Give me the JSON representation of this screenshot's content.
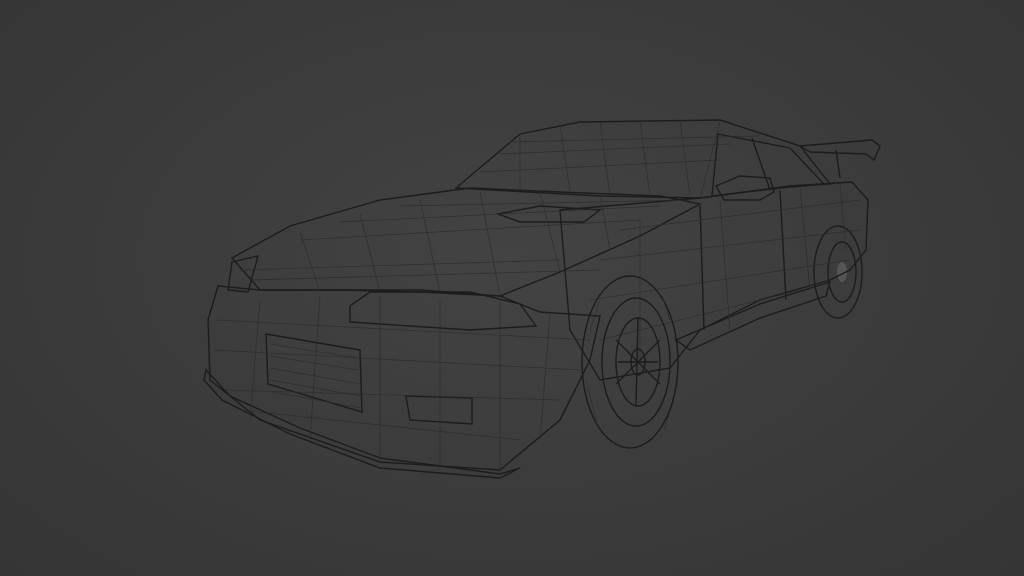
{
  "scene": {
    "subject": "car-wireframe-model",
    "background_color": "#3a3a3a",
    "body_color": "#8f8f8f",
    "wire_color": "#2a2a2a"
  }
}
